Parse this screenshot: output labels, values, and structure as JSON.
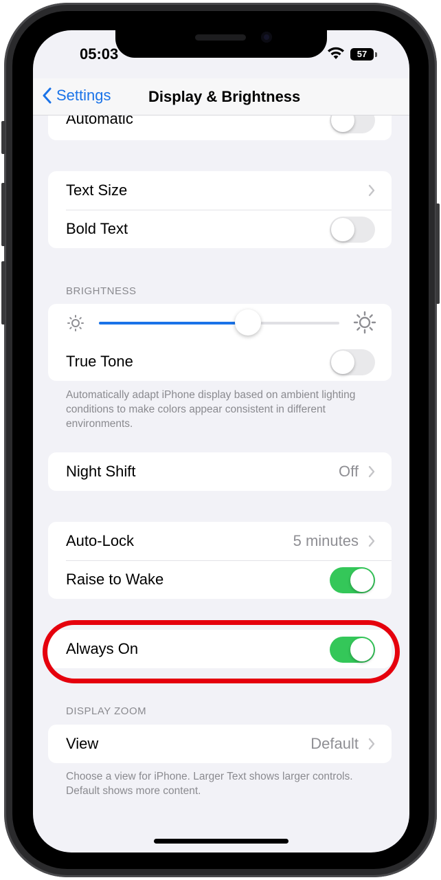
{
  "status_bar": {
    "time": "05:03",
    "battery": "57"
  },
  "nav": {
    "back_label": "Settings",
    "title": "Display & Brightness"
  },
  "groups": {
    "top": {
      "automatic_label": "Automatic",
      "automatic_on": false
    },
    "text": {
      "text_size_label": "Text Size",
      "bold_text_label": "Bold Text",
      "bold_text_on": false
    },
    "brightness": {
      "header": "BRIGHTNESS",
      "level": 0.62,
      "true_tone_label": "True Tone",
      "true_tone_on": false,
      "footnote": "Automatically adapt iPhone display based on ambient lighting conditions to make colors appear consistent in different environments."
    },
    "night_shift": {
      "label": "Night Shift",
      "value": "Off"
    },
    "lock": {
      "auto_lock_label": "Auto-Lock",
      "auto_lock_value": "5 minutes",
      "raise_to_wake_label": "Raise to Wake",
      "raise_to_wake_on": true
    },
    "always_on": {
      "label": "Always On",
      "on": true
    },
    "display_zoom": {
      "header": "DISPLAY ZOOM",
      "view_label": "View",
      "view_value": "Default",
      "footnote": "Choose a view for iPhone. Larger Text shows larger controls. Default shows more content."
    }
  },
  "colors": {
    "accent": "#1a73e8",
    "toggle_on": "#34c759",
    "highlight": "#e5000d",
    "slider_fill": "#1a73e8"
  }
}
